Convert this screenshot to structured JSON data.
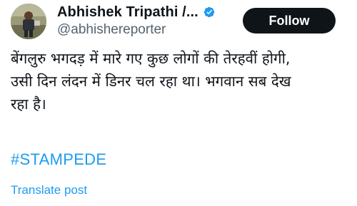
{
  "author": {
    "display_name": "Abhishek Tripathi /...",
    "handle": "@abhishereporter",
    "verified_icon": "verified-badge-icon",
    "verified_color": "#1d9bf0"
  },
  "follow_button": {
    "label": "Follow",
    "background": "#0f1419",
    "text_color": "#ffffff"
  },
  "tweet": {
    "text_line_1": "बेंगलुरु भगदड़ में मारे गए कुछ लोगों की तेरहवीं होगी,",
    "text_line_2": "उसी दिन लंदन में डिनर चल रहा था। भगवान सब देख",
    "text_line_3": "रहा है।",
    "hashtag": "#STAMPEDE",
    "translate_label": "Translate post"
  },
  "colors": {
    "link": "#1d9bf0",
    "secondary_text": "#536471",
    "primary_text": "#0f1419"
  }
}
